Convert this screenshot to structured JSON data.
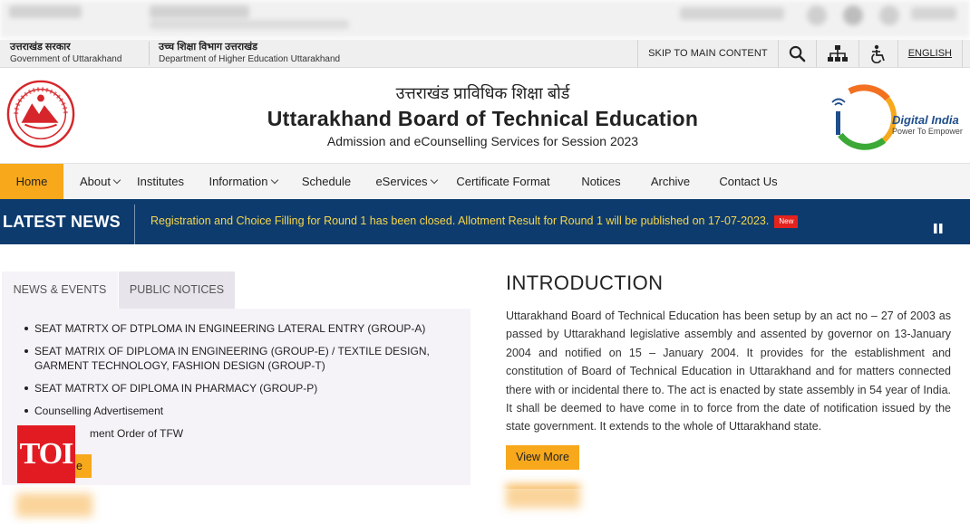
{
  "gov_bar": {
    "gov_hi": "उत्तराखंड सरकार",
    "gov_en": "Government of Uttarakhand",
    "dept_hi": "उच्च शिक्षा विभाग उत्तराखंड",
    "dept_en": "Department of Higher Education Uttarakhand",
    "skip_label": "SKIP TO MAIN CONTENT",
    "language_label": "ENGLISH",
    "icons": [
      "search-icon",
      "sitemap-icon",
      "accessibility-icon"
    ]
  },
  "header": {
    "title_hi": "उत्तराखंड प्राविधिक शिक्षा बोर्ड",
    "title_en": "Uttarakhand Board of Technical Education",
    "subtitle": "Admission and eCounselling Services for Session 2023",
    "digital_india": "Digital India",
    "digital_india_tagline": "Power To Empower"
  },
  "nav": {
    "items": [
      {
        "label": "Home",
        "dropdown": false,
        "active": true
      },
      {
        "label": "About",
        "dropdown": true,
        "active": false
      },
      {
        "label": "Institutes",
        "dropdown": false,
        "active": false
      },
      {
        "label": "Information",
        "dropdown": true,
        "active": false
      },
      {
        "label": "Schedule",
        "dropdown": false,
        "active": false
      },
      {
        "label": "eServices",
        "dropdown": true,
        "active": false
      },
      {
        "label": "Certificate Format",
        "dropdown": false,
        "active": false
      },
      {
        "label": "Notices",
        "dropdown": false,
        "active": false
      },
      {
        "label": "Archive",
        "dropdown": false,
        "active": false
      },
      {
        "label": "Contact Us",
        "dropdown": false,
        "active": false
      }
    ]
  },
  "latest_news": {
    "label": "LATEST NEWS",
    "text": "Registration and Choice Filling for Round 1 has been closed. Allotment Result for Round 1 will be published on 17-07-2023.",
    "badge": "New"
  },
  "left_panel": {
    "tabs": [
      "NEWS & EVENTS",
      "PUBLIC NOTICES"
    ],
    "items": [
      "SEAT MATRTX OF DTPLOMA IN ENGINEERING LATERAL ENTRY (GROUP-A)",
      "SEAT MATRIX OF DIPLOMA IN ENGINEERING (GROUP-E) / TEXTILE DESIGN, GARMENT TECHNOLOGY, FASHION DESIGN (GROUP-T)",
      "SEAT MATRTX OF DIPLOMA IN PHARMACY (GROUP-P)",
      "Counselling Advertisement",
      "Government Order of TFW"
    ],
    "visible_item_5": "ment Order of TFW",
    "button_label": "e"
  },
  "watermark": "TOI",
  "intro": {
    "title": "INTRODUCTION",
    "body": "Uttarakhand Board of Technical Education has been setup by an act no – 27 of 2003 as passed by Uttarakhand legislative assembly and assented by governor on 13-January 2004 and notified on 15 – January 2004. It provides for the establishment and constitution of Board of Technical Education in Uttarakhand and for matters connected there with or incidental there to. The act is enacted by state assembly in 54 year of India. It shall be deemed to have come in to force from the date of notification issued by the state government. It extends to the whole of Uttarakhand state.",
    "button_label": "View More"
  },
  "colors": {
    "accent_orange": "#f7a81b",
    "news_bar_blue": "#0d3b6e",
    "news_text_yellow": "#f7d64a",
    "badge_red": "#e5231e",
    "toi_red": "#e21b23"
  }
}
